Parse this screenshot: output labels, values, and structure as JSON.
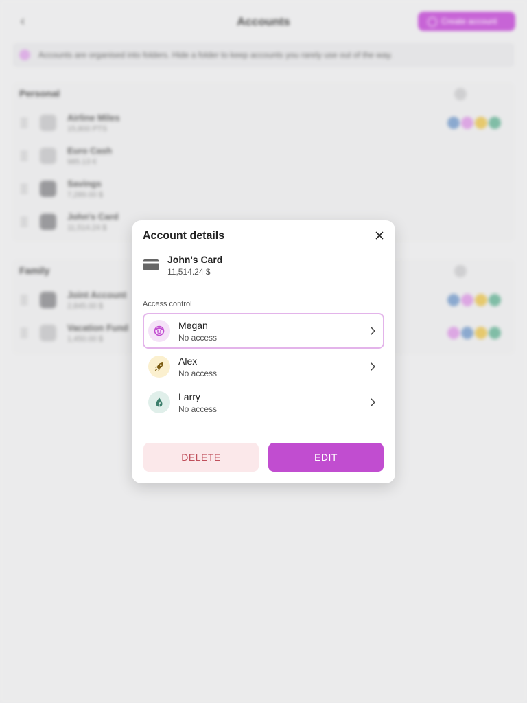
{
  "background": {
    "header": {
      "title": "Accounts",
      "create_label": "Create account"
    },
    "banner": {
      "text": "Accounts are organised into folders. Hide a folder to keep accounts you rarely use out of the way."
    },
    "groups": [
      {
        "title": "Personal",
        "accounts": [
          {
            "name": "Airline Miles",
            "balance": "15,800 PTS"
          },
          {
            "name": "Euro Cash",
            "balance": "985.13 €"
          },
          {
            "name": "Savings",
            "balance": "7,289.00 $"
          },
          {
            "name": "John's Card",
            "balance": "11,514.24 $"
          }
        ]
      },
      {
        "title": "Family",
        "accounts": [
          {
            "name": "Joint Account",
            "balance": "2,845.00 $"
          },
          {
            "name": "Vacation Fund",
            "balance": "1,450.00 $"
          }
        ]
      }
    ]
  },
  "modal": {
    "title": "Account details",
    "account": {
      "name": "John's Card",
      "balance": "11,514.24 $",
      "icon": "credit-card-icon"
    },
    "access_label": "Access control",
    "users": [
      {
        "name": "Megan",
        "access": "No access",
        "icon": "smiley-face-icon",
        "color": "#f5e2f8",
        "icon_color": "#c14dd0"
      },
      {
        "name": "Alex",
        "access": "No access",
        "icon": "rocket-icon",
        "color": "#fbf0cf",
        "icon_color": "#7a5a10"
      },
      {
        "name": "Larry",
        "access": "No access",
        "icon": "leaf-icon",
        "color": "#e0efea",
        "icon_color": "#3d7f6c"
      }
    ],
    "buttons": {
      "delete": "DELETE",
      "edit": "EDIT"
    }
  },
  "colors": {
    "accent": "#c14dd0",
    "danger": "#c0505c",
    "danger_bg": "#fbe8ea"
  }
}
